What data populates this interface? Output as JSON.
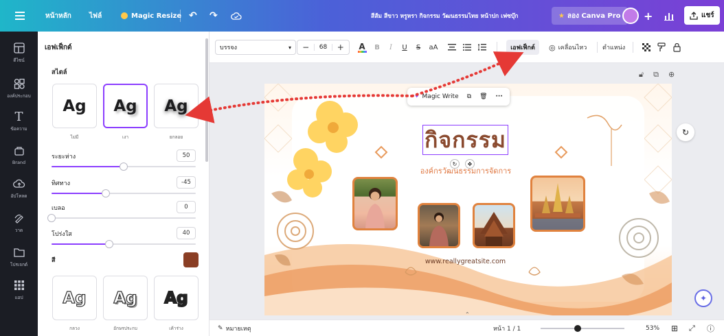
{
  "topbar": {
    "home_label": "หน้าหลัก",
    "file_label": "ไฟล์",
    "magic_resize_label": "Magic Resize",
    "document_title": "สีส้ม สีขาว หรูหรา กิจกรรม วัฒนธรรมไทย หน้าปก เฟซบุ๊ก",
    "try_pro_label": "ลอง Canva Pro",
    "share_label": "แชร์",
    "add_label": "+"
  },
  "rail": {
    "items": [
      {
        "label": "ดีไซน์",
        "icon": "layout-icon"
      },
      {
        "label": "องค์ประกอบ",
        "icon": "elements-icon"
      },
      {
        "label": "ข้อความ",
        "icon": "text-icon"
      },
      {
        "label": "Brand",
        "icon": "brand-icon"
      },
      {
        "label": "อัปโหลด",
        "icon": "upload-icon"
      },
      {
        "label": "วาด",
        "icon": "draw-icon"
      },
      {
        "label": "โปรเจกต์",
        "icon": "folder-icon"
      },
      {
        "label": "แอป",
        "icon": "apps-icon"
      }
    ]
  },
  "panel": {
    "title": "เอฟเฟ็กต์",
    "style_section": "สไตล์",
    "styles": [
      {
        "label": "ไม่มี",
        "text": "Ag"
      },
      {
        "label": "เงา",
        "text": "Ag"
      },
      {
        "label": "ยกลอย",
        "text": "Ag"
      }
    ],
    "sliders": [
      {
        "label": "ระยะห่าง",
        "value": "50",
        "fraction": 0.5
      },
      {
        "label": "ทิศทาง",
        "value": "-45",
        "fraction": 0.375
      },
      {
        "label": "เบลอ",
        "value": "0",
        "fraction": 0.0
      },
      {
        "label": "โปร่งใส",
        "value": "40",
        "fraction": 0.4
      }
    ],
    "color_label": "สี",
    "shadow_color": "#8a3e24",
    "outline_styles": [
      {
        "label": "กลวง",
        "text": "Ag"
      },
      {
        "label": "อักษรประกบ",
        "text": "Ag"
      },
      {
        "label": "เค้าร่าง",
        "text": "Ag"
      }
    ]
  },
  "toolbar": {
    "font_name": "บรรจง",
    "font_size": "68",
    "effects_label": "เอฟเฟ็กต์",
    "animate_label": "เคลื่อนไหว",
    "position_label": "ตำแหน่ง",
    "minus": "−",
    "plus": "+"
  },
  "design": {
    "float_toolbar_label": "Magic Write",
    "title": "กิจกรรม",
    "subtitle": "องค์กรวัฒนธรรมการจัดการ",
    "website": "www.reallygreatsite.com"
  },
  "statusbar": {
    "notes_label": "หมายเหตุ",
    "page_indicator": "หน้า 1 / 1",
    "zoom_percent": "53%",
    "zoom_fraction": 0.44
  },
  "colors": {
    "accent": "#8b3dff",
    "title_brown": "#8a4a2f",
    "orange": "#e0823e",
    "arrow_red": "#e53935"
  }
}
